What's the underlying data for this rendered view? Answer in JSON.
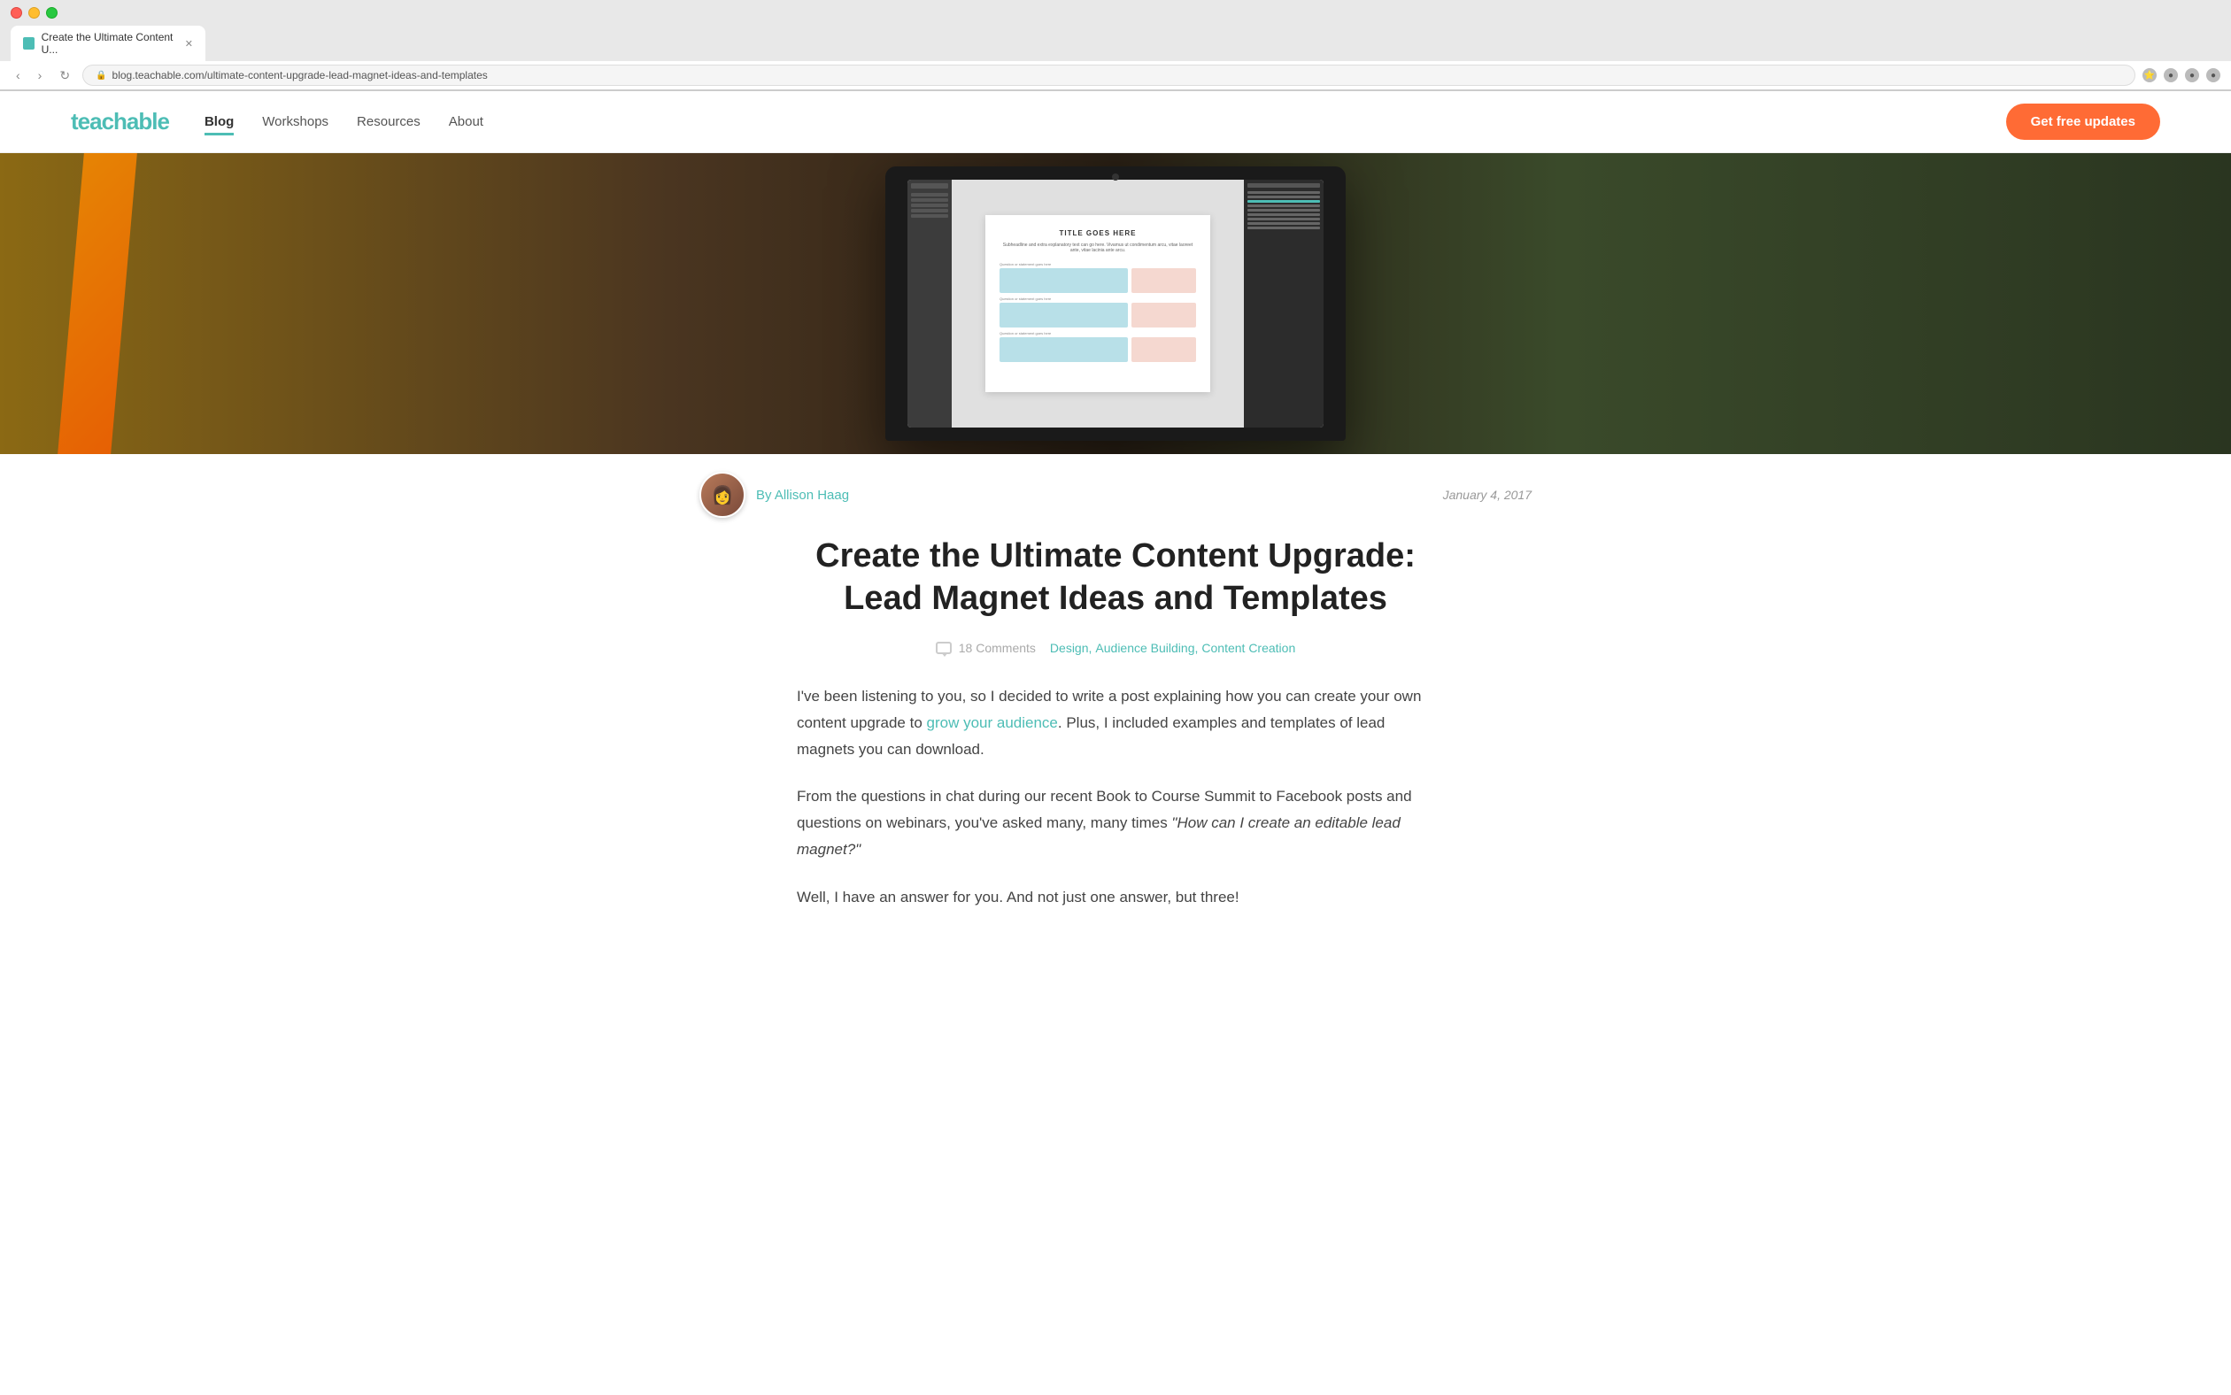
{
  "browser": {
    "tab_title": "Create the Ultimate Content U...",
    "tab_favicon": "T",
    "url": "blog.teachable.com/ultimate-content-upgrade-lead-magnet-ideas-and-templates",
    "nav_back": "‹",
    "nav_forward": "›",
    "nav_reload": "↻"
  },
  "nav": {
    "logo": "teachable",
    "links": [
      {
        "label": "Blog",
        "active": true
      },
      {
        "label": "Workshops",
        "active": false
      },
      {
        "label": "Resources",
        "active": false
      },
      {
        "label": "About",
        "active": false
      }
    ],
    "cta_label": "Get free updates"
  },
  "article": {
    "author_name": "By Allison Haag",
    "author_avatar": "👩",
    "date": "January 4, 2017",
    "title": "Create the Ultimate Content Upgrade: Lead Magnet Ideas and Templates",
    "comments_count": "18 Comments",
    "tags": [
      "Design",
      "Audience Building",
      "Content Creation"
    ],
    "body_p1": "I've been listening to you, so I decided to write a post explaining how you can create your own content upgrade to",
    "body_p1_link": "grow your audience",
    "body_p1_rest": ". Plus, I included examples and templates of lead magnets you can download.",
    "body_p2": "From the questions in chat during our recent Book to Course Summit to Facebook posts and questions on webinars, you've asked many, many times",
    "body_p2_quote": " \"How can I create an editable lead magnet?\"",
    "body_p3": "Well, I have an answer for you. And not just one answer, but three!"
  },
  "laptop": {
    "doc_title": "TITLE GOES HERE",
    "doc_subtitle": "Subheadline and extra explanatory text can go here. Vivamus ut condimentum arcu, vitae laoreet ante, vitae lacinia ante arcu."
  }
}
